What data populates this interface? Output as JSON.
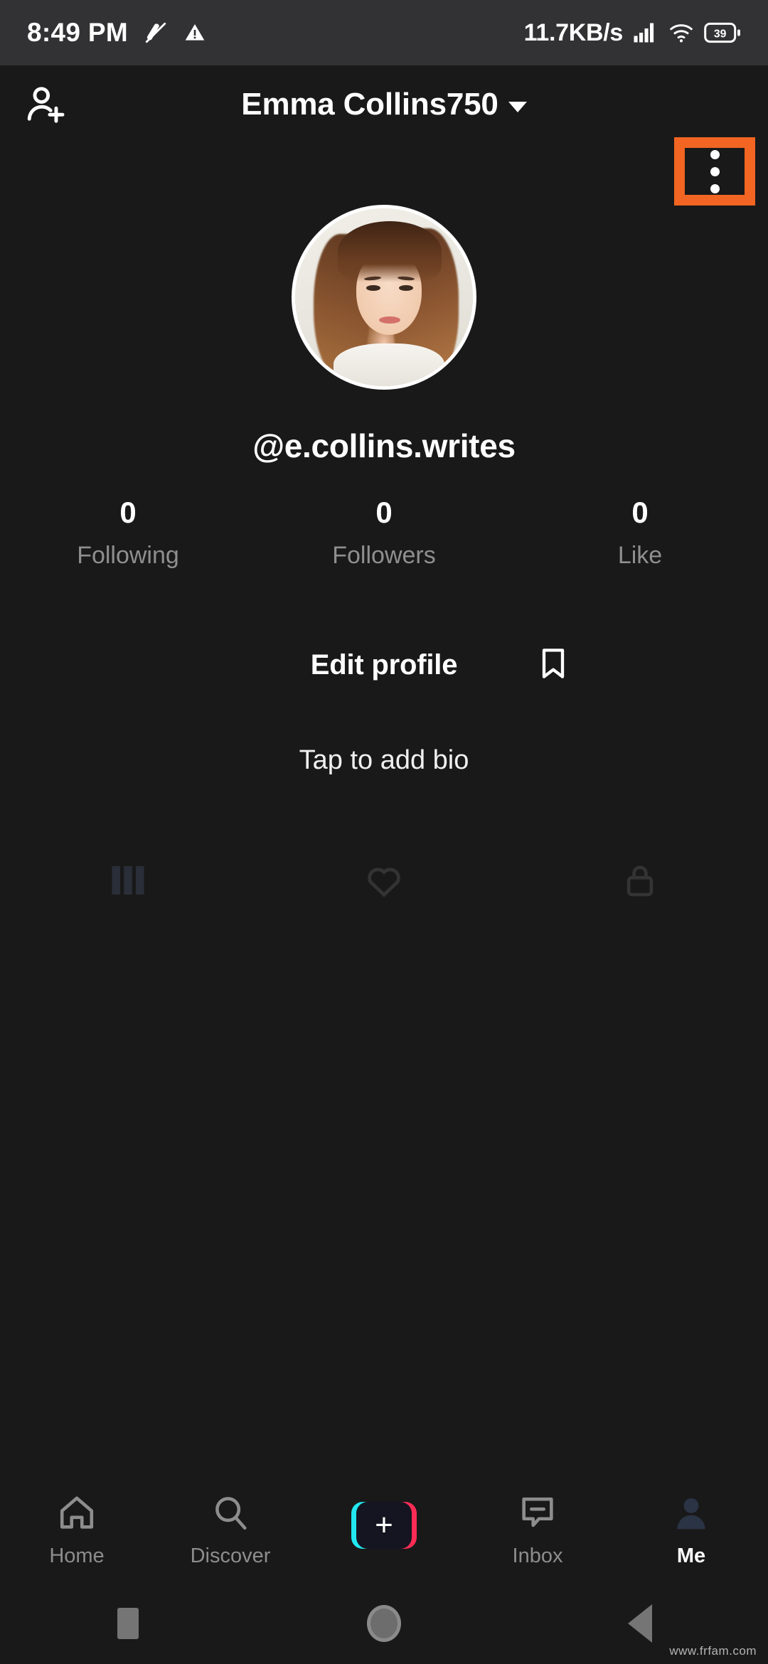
{
  "status_bar": {
    "time": "8:49 PM",
    "icons_left": [
      "silent-mode-icon",
      "warning-triangle-icon"
    ],
    "network_speed": "11.7KB/s",
    "icons_right": [
      "signal-bars-icon",
      "wifi-icon"
    ],
    "battery_level": "39"
  },
  "header": {
    "add_friend_icon": "person-add-icon",
    "title": "Emma Collins750",
    "dropdown_icon": "chevron-down-icon",
    "more_options_icon": "three-dots-vertical-icon",
    "highlight_color": "#f26522"
  },
  "profile": {
    "avatar_alt": "profile-photo",
    "username": "@e.collins.writes",
    "stats": [
      {
        "value": "0",
        "label": "Following"
      },
      {
        "value": "0",
        "label": "Followers"
      },
      {
        "value": "0",
        "label": "Like"
      }
    ],
    "edit_profile_label": "Edit profile",
    "bookmark_icon": "bookmark-icon",
    "bio_placeholder": "Tap to add bio",
    "content_tabs": [
      {
        "icon": "grid-posts-icon",
        "active": true
      },
      {
        "icon": "repost-icon",
        "active": false
      },
      {
        "icon": "lock-private-icon",
        "active": false
      }
    ]
  },
  "bottom_nav": {
    "items": [
      {
        "label": "Home",
        "icon": "home-icon",
        "active": false
      },
      {
        "label": "Discover",
        "icon": "search-icon",
        "active": false
      },
      {
        "label": "",
        "icon": "create-plus-icon",
        "active": false
      },
      {
        "label": "Inbox",
        "icon": "message-icon",
        "active": false
      },
      {
        "label": "Me",
        "icon": "person-icon",
        "active": true
      }
    ],
    "create_plus": "+",
    "accent_cyan": "#22e7ef",
    "accent_pink": "#fe2c55"
  },
  "android_nav": {
    "recents_icon": "square-recents-icon",
    "home_icon": "circle-home-icon",
    "back_icon": "triangle-back-icon"
  },
  "watermark": "www.frfam.com"
}
